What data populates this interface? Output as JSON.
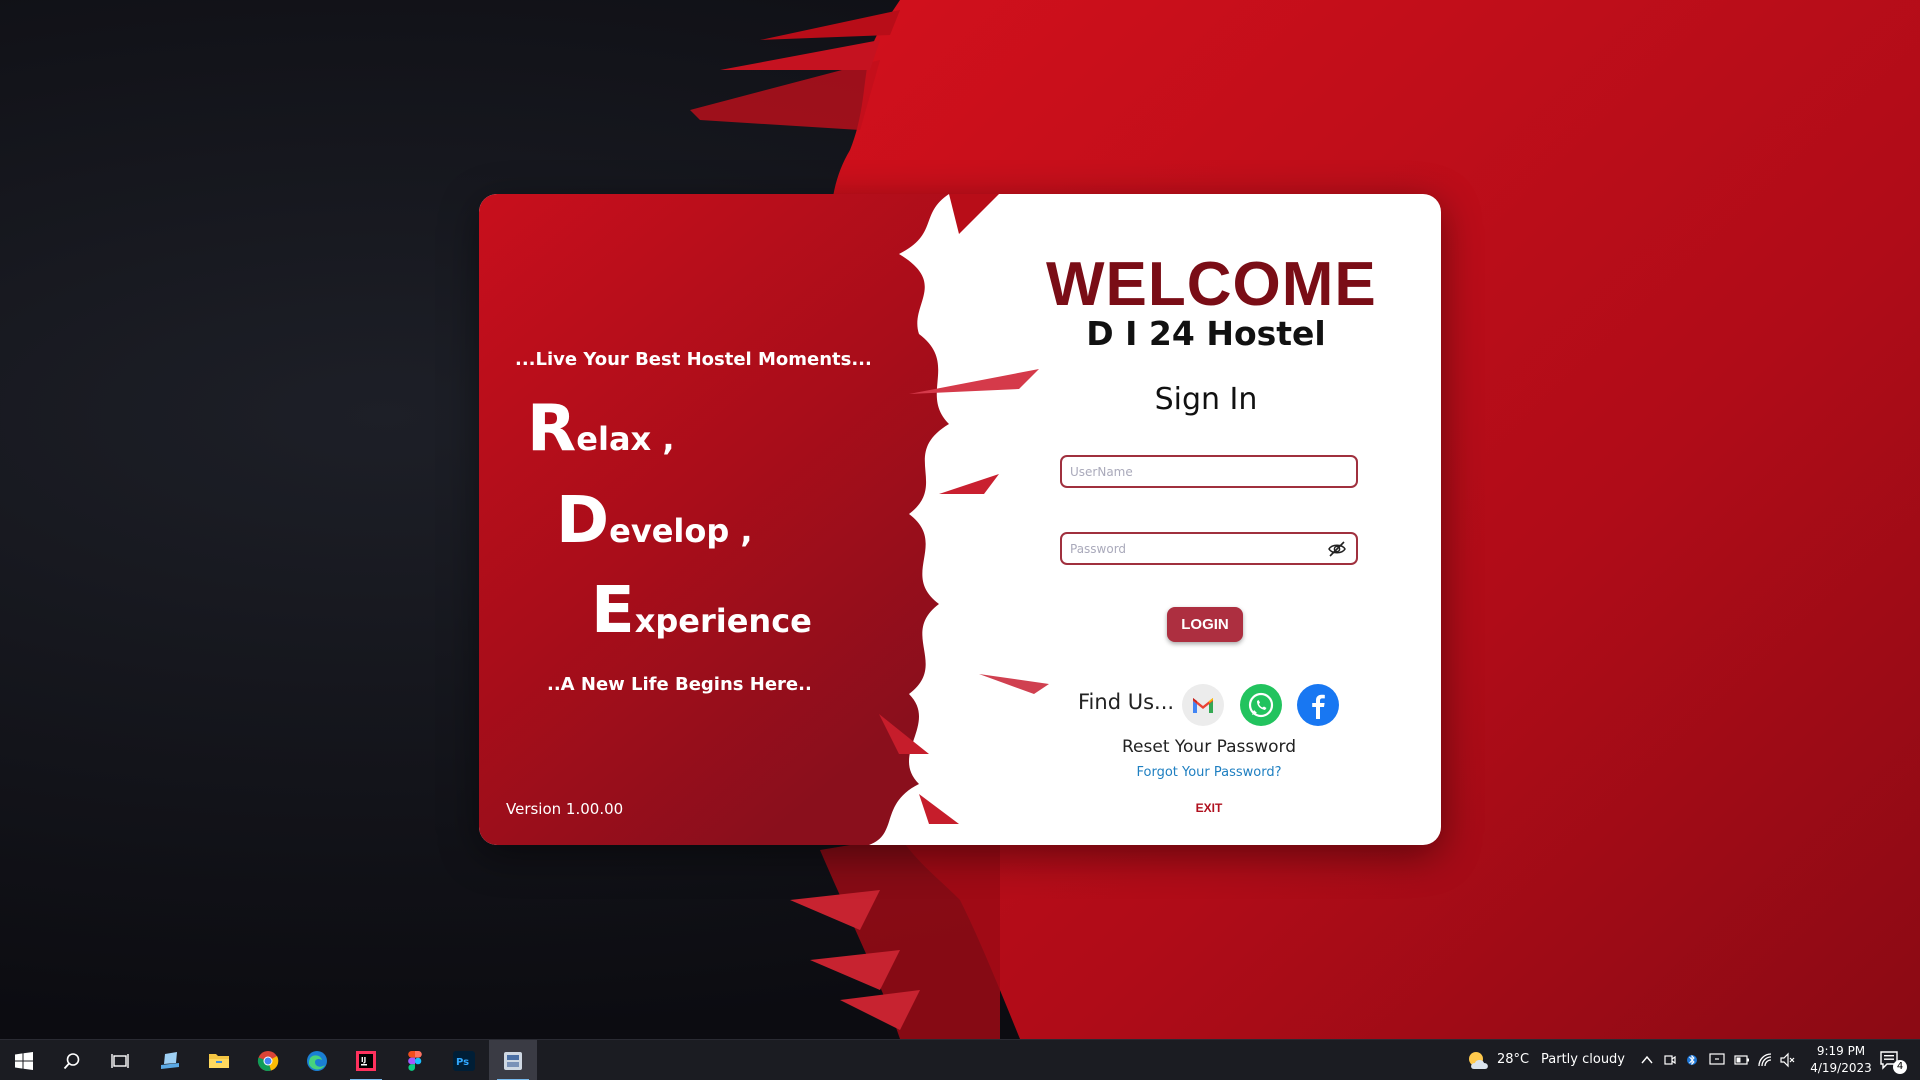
{
  "login": {
    "slogan_top": "...Live Your Best Hostel Moments...",
    "words": [
      {
        "initial": "R",
        "rest": "elax ,"
      },
      {
        "initial": "D",
        "rest": "evelop ,"
      },
      {
        "initial": "E",
        "rest": "xperience"
      }
    ],
    "slogan_bottom": "..A New Life Begins Here..",
    "version": "Version 1.00.00",
    "welcome": "WELCOME",
    "hostel_name": "D I 24  Hostel",
    "sign_in": "Sign In",
    "username_placeholder": "UserName",
    "password_placeholder": "Password",
    "login_button": "LOGIN",
    "find_us": "Find Us...",
    "reset_title": "Reset Your Password",
    "forgot_link": "Forgot Your Password?",
    "exit": "EXIT",
    "social_icons": [
      "gmail-icon",
      "whatsapp-icon",
      "facebook-icon"
    ]
  },
  "taskbar": {
    "pinned": [
      "windows-start-icon",
      "search-icon",
      "task-view-icon",
      "app-icon",
      "file-explorer-icon",
      "chrome-icon",
      "edge-icon",
      "intellij-icon",
      "figma-icon",
      "photoshop-icon",
      "active-app-icon"
    ],
    "weather_temp": "28°C",
    "weather_desc": "Partly cloudy",
    "time": "9:19 PM",
    "date": "4/19/2023",
    "notification_count": "4"
  },
  "colors": {
    "accent_red": "#c4101d",
    "dark_red": "#7a0d16",
    "button": "#ad2f40",
    "link": "#1e7fc1"
  }
}
